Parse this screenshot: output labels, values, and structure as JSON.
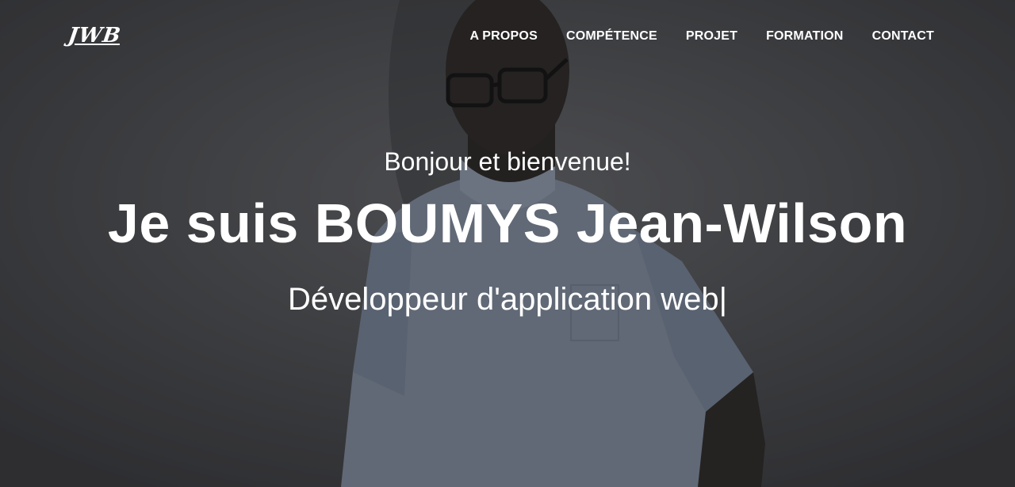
{
  "brand": {
    "logo_text": "JWB"
  },
  "nav": {
    "items": [
      {
        "label": "A PROPOS"
      },
      {
        "label": "COMPÉTENCE"
      },
      {
        "label": "PROJET"
      },
      {
        "label": "FORMATION"
      },
      {
        "label": "CONTACT"
      }
    ]
  },
  "hero": {
    "greeting": "Bonjour et bienvenue!",
    "headline": "Je suis BOUMYS Jean-Wilson",
    "role": "Développeur d'application web|",
    "background_image": "portrait photo of a man with glasses in a light blue shirt"
  },
  "colors": {
    "text": "#ffffff",
    "overlay": "#141416",
    "backdrop": "#3a3b3d",
    "shirt": "#8f9cb0"
  }
}
